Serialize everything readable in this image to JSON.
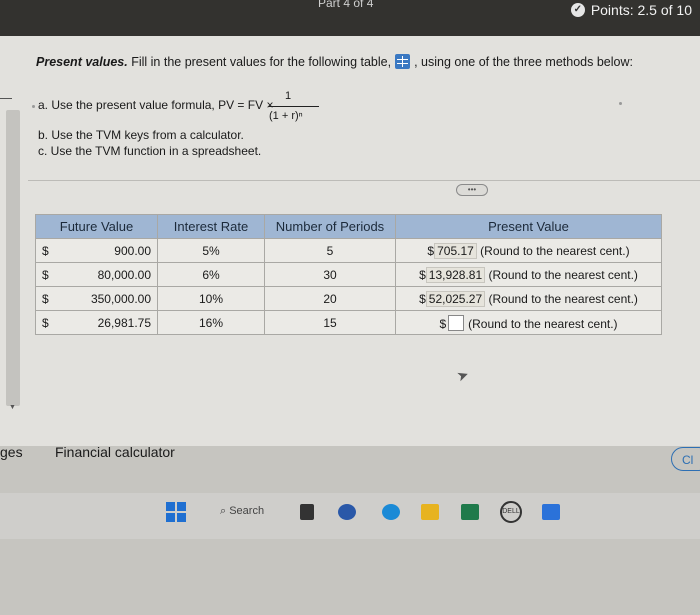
{
  "header": {
    "part_label": "Part 4 of 4",
    "points_label": "Points: 2.5 of 10"
  },
  "question": {
    "title": "Present values.",
    "text_before_icon": "Fill in the present values for the following table,",
    "text_after_icon": ", using one of the three methods below:",
    "method_a": "a. Use the present value formula, PV = FV ×",
    "formula_numerator": "1",
    "formula_denominator": "(1 + r)ⁿ",
    "method_b": "b. Use the TVM keys from a calculator.",
    "method_c": "c. Use the TVM function in a spreadsheet."
  },
  "table": {
    "headers": [
      "Future Value",
      "Interest Rate",
      "Number of Periods",
      "Present Value"
    ],
    "rows": [
      {
        "fv_symbol": "$",
        "fv_amount": "900.00",
        "rate": "5%",
        "periods": "5",
        "pv_prefix": "$",
        "pv_answer": "705.17",
        "pv_hint": "(Round to the nearest cent.)"
      },
      {
        "fv_symbol": "$",
        "fv_amount": "80,000.00",
        "rate": "6%",
        "periods": "30",
        "pv_prefix": "$",
        "pv_answer": "13,928.81",
        "pv_hint": "(Round to the nearest cent.)"
      },
      {
        "fv_symbol": "$",
        "fv_amount": "350,000.00",
        "rate": "10%",
        "periods": "20",
        "pv_prefix": "$",
        "pv_answer": "52,025.27",
        "pv_hint": "(Round to the nearest cent.)"
      },
      {
        "fv_symbol": "$",
        "fv_amount": "26,981.75",
        "rate": "16%",
        "periods": "15",
        "pv_prefix": "$",
        "pv_answer": "",
        "pv_hint": "(Round to the nearest cent.)"
      }
    ]
  },
  "bottom": {
    "cut_label": "ges",
    "financial_calculator": "Financial calculator",
    "clear_button": "Cl"
  },
  "taskbar": {
    "search_label": "Search",
    "dell_label": "DELL"
  },
  "colors": {
    "table_header": "#9fb6d3",
    "top_bar": "#33322f",
    "accent": "#2d6fb3"
  }
}
